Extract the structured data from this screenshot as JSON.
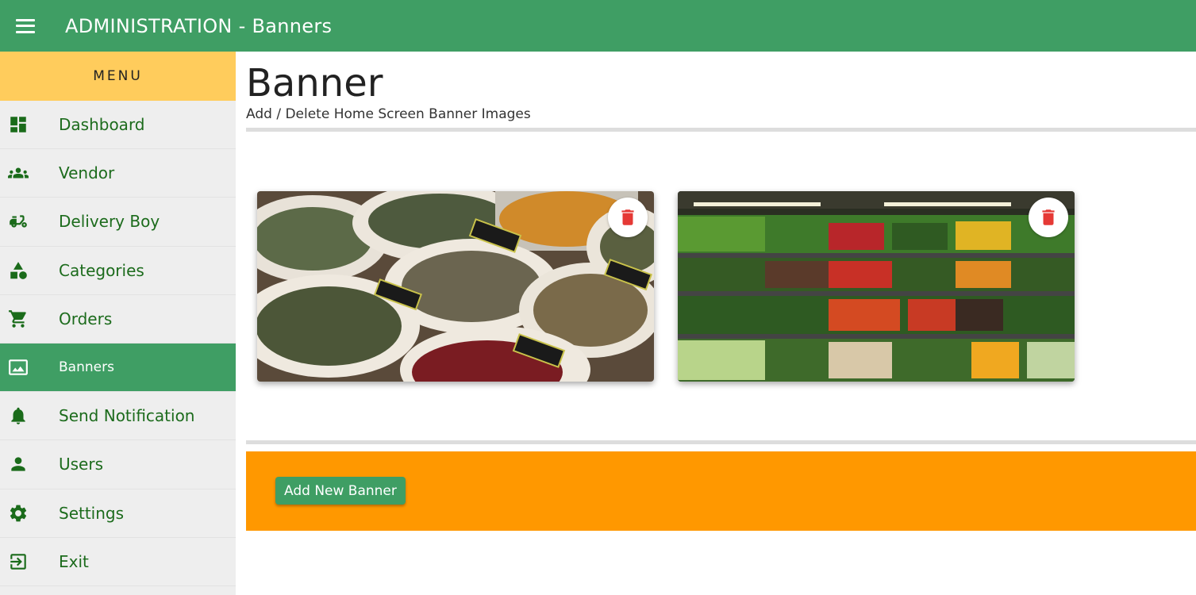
{
  "app": {
    "title": "ADMINISTRATION - Banners"
  },
  "sidebar": {
    "header": "MENU",
    "items": [
      {
        "label": "Dashboard",
        "icon": "dashboard-icon"
      },
      {
        "label": "Vendor",
        "icon": "group-icon"
      },
      {
        "label": "Delivery Boy",
        "icon": "delivery-scooter-icon"
      },
      {
        "label": "Categories",
        "icon": "shapes-icon"
      },
      {
        "label": "Orders",
        "icon": "cart-icon"
      },
      {
        "label": "Banners",
        "icon": "image-icon",
        "active": true
      },
      {
        "label": "Send Notification",
        "icon": "bell-icon"
      },
      {
        "label": "Users",
        "icon": "person-icon"
      },
      {
        "label": "Settings",
        "icon": "gear-icon"
      },
      {
        "label": "Exit",
        "icon": "exit-icon"
      }
    ]
  },
  "main": {
    "title": "Banner",
    "subtitle": "Add / Delete Home Screen Banner Images",
    "banners": [
      {
        "image": "spices-in-sacks-photo"
      },
      {
        "image": "vegetable-shelves-photo"
      }
    ],
    "add_button": "Add New Banner"
  },
  "colors": {
    "primary": "#3f9e64",
    "menu_header": "#ffcc5c",
    "action_bar": "#ff9800",
    "delete": "#e53935"
  }
}
